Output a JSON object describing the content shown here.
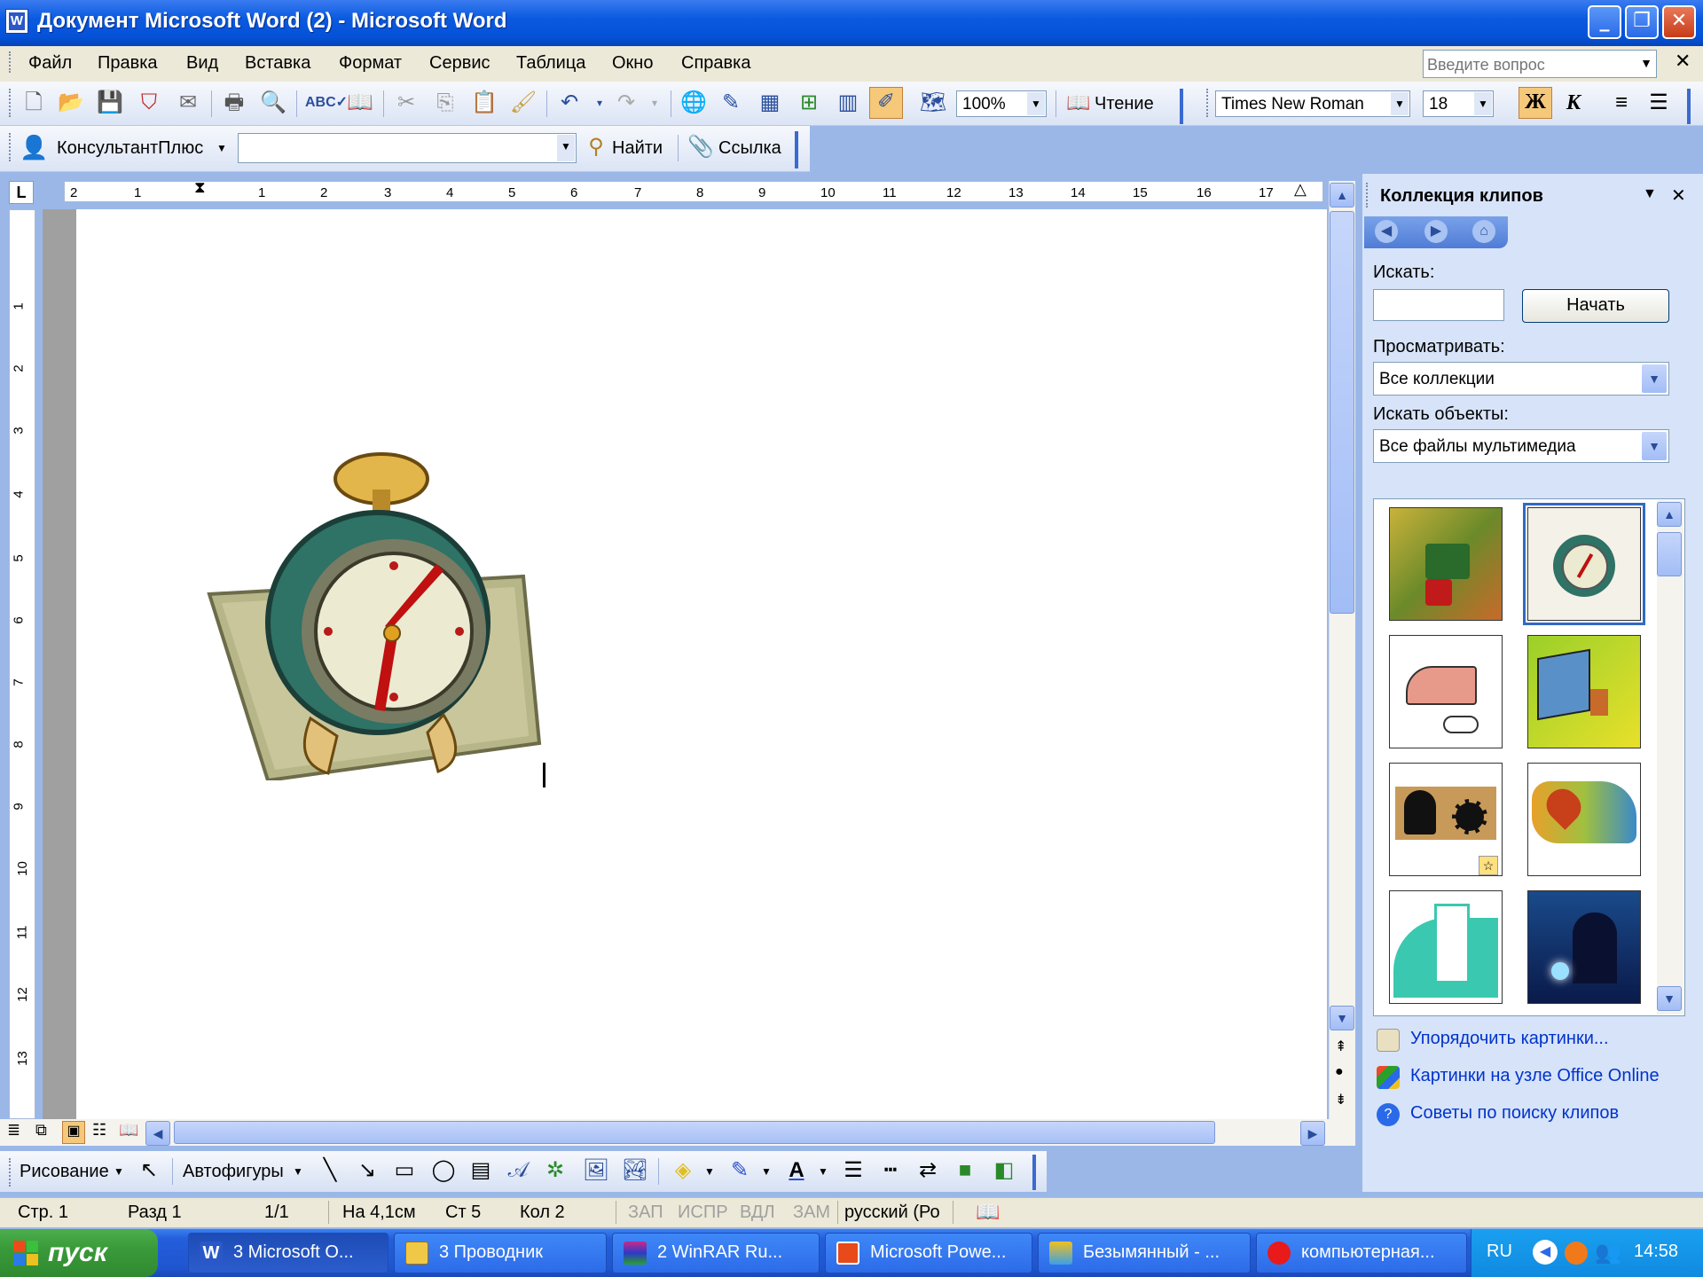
{
  "window": {
    "title": "Документ Microsoft Word (2) - Microsoft Word"
  },
  "menu": {
    "items": [
      "Файл",
      "Правка",
      "Вид",
      "Вставка",
      "Формат",
      "Сервис",
      "Таблица",
      "Окно",
      "Справка"
    ],
    "ask_placeholder": "Введите вопрос"
  },
  "toolbar": {
    "zoom": "100%",
    "reading_label": "Чтение",
    "font_name": "Times New Roman",
    "font_size": "18",
    "bold_label": "Ж",
    "italic_label": "К"
  },
  "consultant": {
    "label": "КонсультантПлюс",
    "find_label": "Найти",
    "link_label": "Ссылка"
  },
  "ruler": {
    "h_ticks": [
      "2",
      "1",
      "1",
      "2",
      "3",
      "4",
      "5",
      "6",
      "7",
      "8",
      "9",
      "10",
      "11",
      "12",
      "13",
      "14",
      "15",
      "16",
      "17"
    ],
    "v_ticks": [
      "1",
      "2",
      "3",
      "4",
      "5",
      "6",
      "7",
      "8",
      "9",
      "10",
      "11",
      "12",
      "13"
    ]
  },
  "clipart_pane": {
    "title": "Коллекция клипов",
    "search_label": "Искать:",
    "search_value": "",
    "go_button": "Начать",
    "browse_label": "Просматривать:",
    "browse_value": "Все коллекции",
    "type_label": "Искать объекты:",
    "type_value": "Все файлы мультимедиа",
    "results": [
      "agriculture-clip",
      "alarm-clock-clip",
      "iron-clip",
      "computer-clip",
      "gears-clip",
      "chart-clip",
      "building-clip",
      "welder-clip"
    ],
    "links": [
      "Упорядочить картинки...",
      "Картинки на узле Office Online",
      "Советы по поиску клипов"
    ]
  },
  "drawing": {
    "draw_label": "Рисование",
    "autoshapes_label": "Автофигуры"
  },
  "status": {
    "page": "Стр. 1",
    "section": "Разд 1",
    "pages": "1/1",
    "at": "На 4,1см",
    "line": "Ст 5",
    "col": "Кол 2",
    "rec": "ЗАП",
    "trk": "ИСПР",
    "ext": "ВДЛ",
    "ovr": "ЗАМ",
    "lang": "русский (Ро"
  },
  "taskbar": {
    "start_label": "пуск",
    "tasks": [
      "3 Microsoft O...",
      "3 Проводник",
      "2 WinRAR Ru...",
      "Microsoft Powe...",
      "Безымянный - ...",
      "компьютерная..."
    ],
    "lang": "RU",
    "time": "14:58"
  },
  "colors": {
    "title_bar": "#0a5ae0",
    "taskbar": "#245edb",
    "start": "#3a9a3a",
    "link": "#0033cc"
  }
}
